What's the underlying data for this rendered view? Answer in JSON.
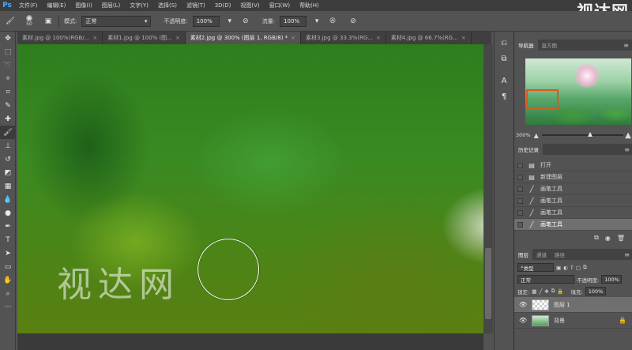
{
  "app": {
    "logo": "Ps",
    "menu": [
      "文件(F)",
      "编辑(E)",
      "图像(I)",
      "图层(L)",
      "文字(Y)",
      "选择(S)",
      "滤镜(T)",
      "3D(D)",
      "视图(V)",
      "窗口(W)",
      "帮助(H)"
    ],
    "watermark": "视达网"
  },
  "options": {
    "brush_size": "50",
    "mode_label": "模式:",
    "mode_value": "正常",
    "opacity_label": "不透明度:",
    "opacity_value": "100%",
    "flow_label": "流量:",
    "flow_value": "100%"
  },
  "tabs": [
    {
      "label": "素材.jpg @ 100%(RGB/...",
      "active": false
    },
    {
      "label": "素材1.jpg @ 100% (图...",
      "active": false
    },
    {
      "label": "素材2.jpg @ 300% (图层 1, RGB/8) *",
      "active": true
    },
    {
      "label": "素材3.jpg @ 33.3%(RG...",
      "active": false
    },
    {
      "label": "素材4.jpg @ 66.7%(RG...",
      "active": false
    }
  ],
  "tools": [
    {
      "icon": "move-icon",
      "glyph": "✥"
    },
    {
      "icon": "marquee-icon",
      "glyph": "⬚"
    },
    {
      "icon": "lasso-icon",
      "glyph": "➰"
    },
    {
      "icon": "magic-wand-icon",
      "glyph": "✧"
    },
    {
      "icon": "crop-icon",
      "glyph": "⌗"
    },
    {
      "icon": "eyedropper-icon",
      "glyph": "✎"
    },
    {
      "icon": "healing-brush-icon",
      "glyph": "✚"
    },
    {
      "icon": "brush-icon",
      "glyph": "🖌"
    },
    {
      "icon": "clone-stamp-icon",
      "glyph": "⊥"
    },
    {
      "icon": "history-brush-icon",
      "glyph": "↺"
    },
    {
      "icon": "eraser-icon",
      "glyph": "◩"
    },
    {
      "icon": "gradient-icon",
      "glyph": "▦"
    },
    {
      "icon": "blur-icon",
      "glyph": "💧"
    },
    {
      "icon": "dodge-icon",
      "glyph": "●"
    },
    {
      "icon": "pen-icon",
      "glyph": "✒"
    },
    {
      "icon": "type-icon",
      "glyph": "T"
    },
    {
      "icon": "path-selection-icon",
      "glyph": "➤"
    },
    {
      "icon": "shape-icon",
      "glyph": "▭"
    },
    {
      "icon": "hand-icon",
      "glyph": "✋"
    },
    {
      "icon": "zoom-icon",
      "glyph": "⌕"
    },
    {
      "icon": "more-tools-icon",
      "glyph": "⋯"
    }
  ],
  "canvas": {
    "logo_text": "视达网"
  },
  "navigator": {
    "tabs": [
      "导航器",
      "直方图"
    ],
    "zoom": "300%",
    "zoom_fraction": 0.56
  },
  "history": {
    "tab": "历史记录",
    "items": [
      {
        "label": "打开",
        "icon": "document-icon",
        "glyph": "▤"
      },
      {
        "label": "新建图层",
        "icon": "new-layer-icon",
        "glyph": "▤"
      },
      {
        "label": "画笔工具",
        "icon": "brush-icon",
        "glyph": "╱"
      },
      {
        "label": "画笔工具",
        "icon": "brush-icon",
        "glyph": "╱"
      },
      {
        "label": "画笔工具",
        "icon": "brush-icon",
        "glyph": "╱"
      },
      {
        "label": "画笔工具",
        "icon": "brush-icon",
        "glyph": "╱"
      }
    ],
    "selected_index": 5
  },
  "layers": {
    "tabs": [
      "图层",
      "通道",
      "路径"
    ],
    "filter_label": "类型",
    "blend_mode": "正常",
    "opacity_label": "不透明度:",
    "opacity_value": "100%",
    "lock_label": "锁定:",
    "fill_label": "填充:",
    "fill_value": "100%",
    "items": [
      {
        "name": "图层 1",
        "selected": true
      },
      {
        "name": "背景",
        "selected": false
      }
    ]
  }
}
